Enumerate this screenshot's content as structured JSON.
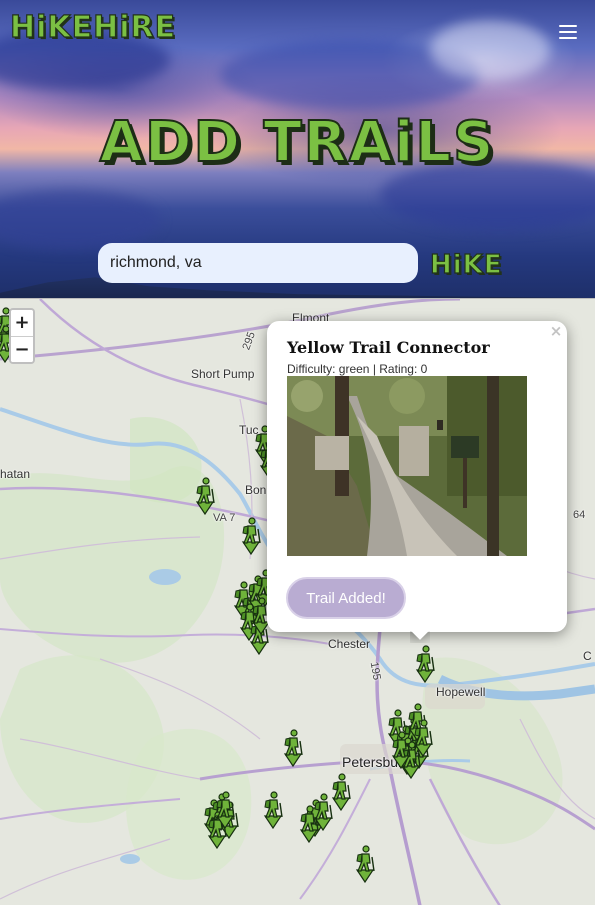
{
  "header": {
    "brand": "HiKEHiRE",
    "menu_icon": "hamburger-menu-icon"
  },
  "hero": {
    "title": "ADD TRAiLS",
    "search_value": "richmond, va",
    "search_button": "HiKE"
  },
  "map": {
    "zoom_in": "+",
    "zoom_out": "−",
    "labels": {
      "elmont": "Elmont",
      "short_pump": "Short Pump",
      "tuc": "Tuc",
      "bon": "Bon",
      "hatan": "hatan",
      "chester": "Chester",
      "hopewell": "Hopewell",
      "petersburg": "Petersburg",
      "c": "C",
      "va7": "VA 7",
      "i295": "295",
      "i95": "195",
      "r64": "64"
    },
    "marker_icon": "hiker-marker-icon"
  },
  "popup": {
    "close": "×",
    "title": "Yellow Trail Connector",
    "meta": "Difficulty: green | Rating: 0",
    "photo_icon": "trail-photo",
    "action_label": "Trail Added!"
  }
}
